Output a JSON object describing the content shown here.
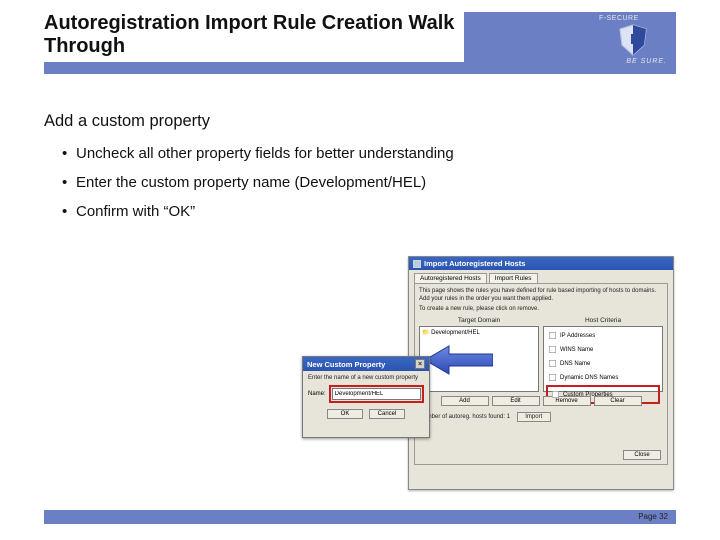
{
  "header": {
    "title": "Autoregistration Import Rule Creation Walk Through",
    "brand": "F-SECURE",
    "tagline": "BE SURE."
  },
  "content": {
    "subtitle": "Add a custom property",
    "bullets": [
      "Uncheck all other property fields for better understanding",
      "Enter the custom property name (Development/HEL)",
      "Confirm with “OK”"
    ]
  },
  "import_window": {
    "title": "Import Autoregistered Hosts",
    "tabs": [
      "Autoregistered Hosts",
      "Import Rules"
    ],
    "desc1": "This page shows the rules you have defined for rule based importing of hosts to domains. Add your rules in the order you want them applied.",
    "desc2": "To create a new rule, please click on remove.",
    "left_header": "Target Domain",
    "right_header": "Host Criteria",
    "left_item": "Development/HEL",
    "right_items": [
      "IP Addresses",
      "WINS Name",
      "DNS Name",
      "Dynamic DNS Names",
      "Custom Properties"
    ],
    "buttons": {
      "add": "Add",
      "edit": "Edit",
      "remove": "Remove",
      "clear": "Clear"
    },
    "bottom_label": "Number of autoreg. hosts found:",
    "bottom_value": "1",
    "import_btn": "Import",
    "close_btn": "Close"
  },
  "prop_dialog": {
    "title": "New Custom Property",
    "text": "Enter the name of a new custom property",
    "name_label": "Name:",
    "value": "Development/HEL",
    "ok": "OK",
    "cancel": "Cancel"
  },
  "footer": {
    "page_label": "Page 32"
  }
}
